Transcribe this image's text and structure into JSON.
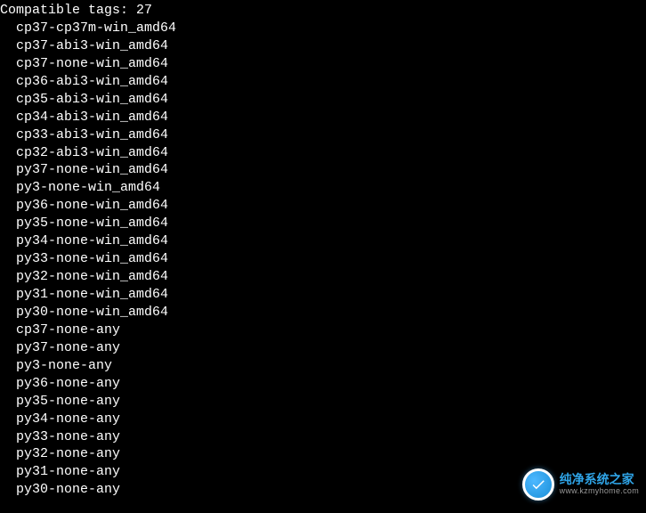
{
  "terminal": {
    "header": "Compatible tags: 27",
    "tags": [
      "cp37-cp37m-win_amd64",
      "cp37-abi3-win_amd64",
      "cp37-none-win_amd64",
      "cp36-abi3-win_amd64",
      "cp35-abi3-win_amd64",
      "cp34-abi3-win_amd64",
      "cp33-abi3-win_amd64",
      "cp32-abi3-win_amd64",
      "py37-none-win_amd64",
      "py3-none-win_amd64",
      "py36-none-win_amd64",
      "py35-none-win_amd64",
      "py34-none-win_amd64",
      "py33-none-win_amd64",
      "py32-none-win_amd64",
      "py31-none-win_amd64",
      "py30-none-win_amd64",
      "cp37-none-any",
      "py37-none-any",
      "py3-none-any",
      "py36-none-any",
      "py35-none-any",
      "py34-none-any",
      "py33-none-any",
      "py32-none-any",
      "py31-none-any",
      "py30-none-any"
    ]
  },
  "watermark": {
    "main": "纯净系统之家",
    "sub": "www.kzmyhome.com"
  }
}
